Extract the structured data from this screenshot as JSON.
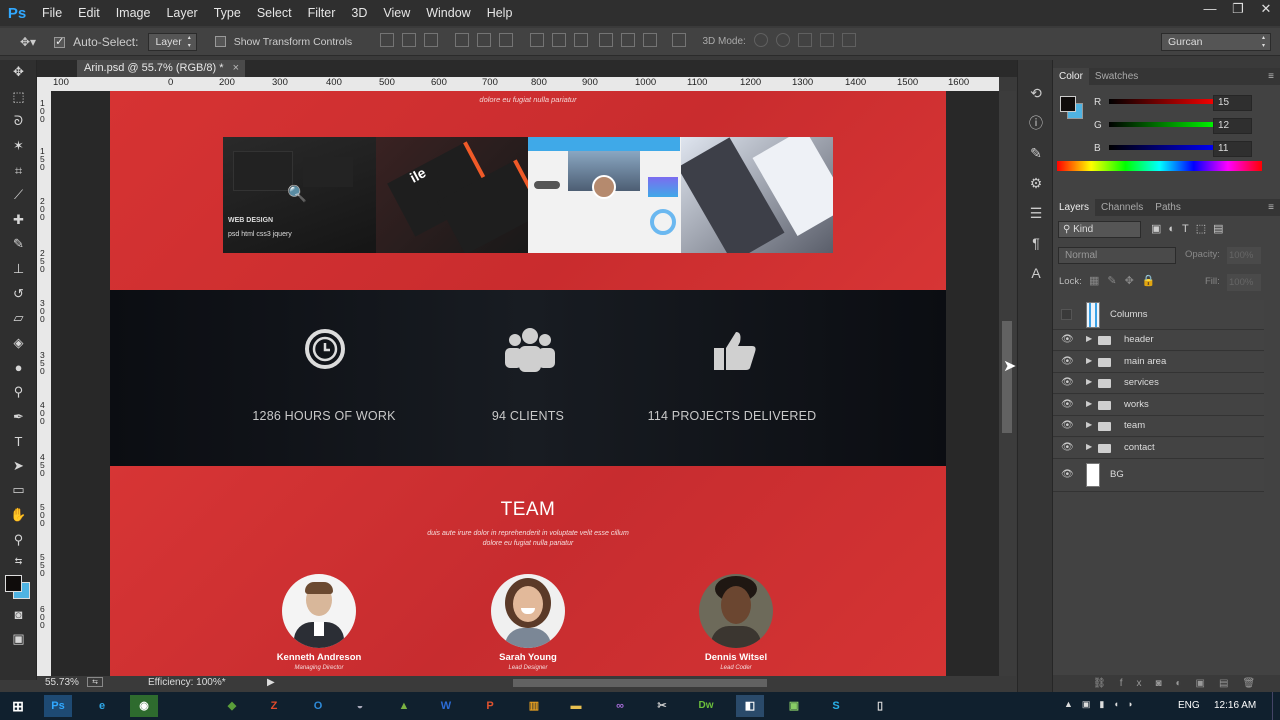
{
  "app": {
    "logo": "Ps",
    "menu": [
      "File",
      "Edit",
      "Image",
      "Layer",
      "Type",
      "Select",
      "Filter",
      "3D",
      "View",
      "Window",
      "Help"
    ],
    "window_controls": [
      "—",
      "❐",
      "✕"
    ]
  },
  "options": {
    "auto_select_label": "Auto-Select:",
    "auto_select_value": "Layer",
    "show_transform_label": "Show Transform Controls",
    "mode_3d_label": "3D Mode:",
    "workspace": "Gurcan"
  },
  "document": {
    "tab_title": "Arin.psd @ 55.7% (RGB/8) *",
    "tab_close": "×",
    "ruler_top": [
      "100",
      "0",
      "100",
      "200",
      "300",
      "400",
      "500",
      "600",
      "700",
      "800",
      "900",
      "1000",
      "1100",
      "1200",
      "1300",
      "1400",
      "1500",
      "1600"
    ],
    "ruler_left": [
      "100",
      "150",
      "200",
      "250",
      "300",
      "350",
      "400",
      "450",
      "500",
      "550",
      "600"
    ]
  },
  "page": {
    "tagline_top": "dolore eu fugiat nulla pariatur",
    "gallery_overlay": {
      "title": "WEB DESIGN",
      "tags": "psd  html  css3  jquery"
    },
    "stats": [
      {
        "icon": "clock-icon",
        "text": "1286 HOURS OF WORK"
      },
      {
        "icon": "users-icon",
        "text": "94 CLIENTS"
      },
      {
        "icon": "thumbs-up-icon",
        "text": "114 PROJECTS DELIVERED"
      }
    ],
    "team": {
      "title": "TEAM",
      "subtitle_1": "duis aute irure dolor in reprehenderit in voluptate velit esse cillum",
      "subtitle_2": "dolore eu fugiat nulla pariatur",
      "members": [
        {
          "name": "Kenneth Andreson",
          "role": "Managing Director"
        },
        {
          "name": "Sarah Young",
          "role": "Lead Designer"
        },
        {
          "name": "Dennis Witsel",
          "role": "Lead Coder"
        }
      ]
    }
  },
  "status": {
    "zoom": "55.73%",
    "efficiency": "Efficiency: 100%*"
  },
  "color_panel": {
    "tabs": [
      "Color",
      "Swatches"
    ],
    "r_label": "R",
    "g_label": "G",
    "b_label": "B",
    "r": "15",
    "g": "12",
    "b": "11",
    "fg_color": "#0f0c0b",
    "bg_color": "#4fb3e2"
  },
  "layers_panel": {
    "tabs": [
      "Layers",
      "Channels",
      "Paths"
    ],
    "filter": "Kind",
    "blend": "Normal",
    "opacity_label": "Opacity:",
    "opacity": "100%",
    "lock_label": "Lock:",
    "fill_label": "Fill:",
    "fill": "100%",
    "layers": [
      {
        "name": "Columns",
        "type": "smart"
      },
      {
        "name": "header",
        "type": "group"
      },
      {
        "name": "main area",
        "type": "group"
      },
      {
        "name": "services",
        "type": "group"
      },
      {
        "name": "works",
        "type": "group"
      },
      {
        "name": "team",
        "type": "group"
      },
      {
        "name": "contact",
        "type": "group"
      },
      {
        "name": "BG",
        "type": "bg"
      }
    ]
  },
  "taskbar": {
    "lang": "ENG",
    "time": "12:16 AM"
  }
}
